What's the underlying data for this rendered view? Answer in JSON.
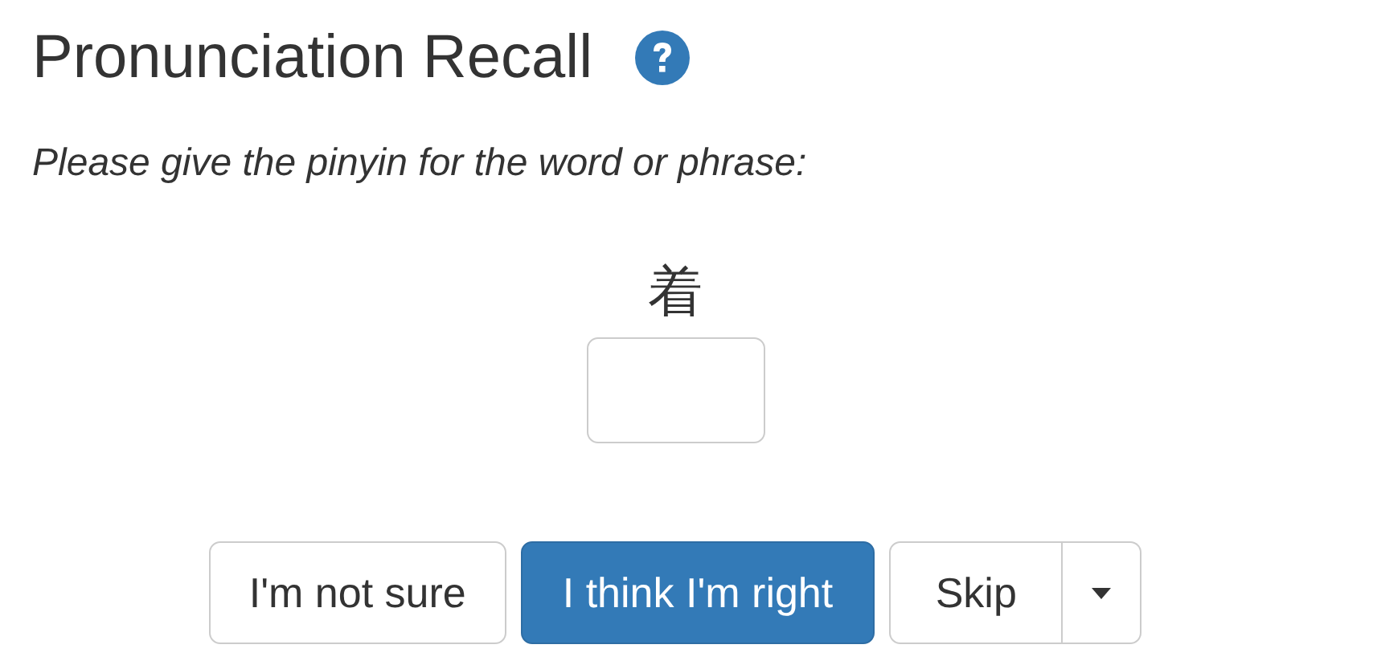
{
  "title": "Pronunciation Recall",
  "prompt": "Please give the pinyin for the word or phrase:",
  "word": "着",
  "buttons": [
    {
      "label": "I'm not sure",
      "kind": "default"
    },
    {
      "label": "I think I'm right",
      "kind": "primary"
    },
    {
      "label": "Skip",
      "kind": "split"
    }
  ]
}
